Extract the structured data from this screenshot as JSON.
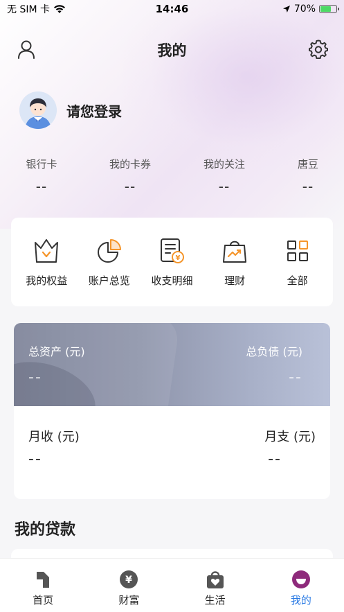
{
  "status_bar": {
    "carrier": "无 SIM 卡",
    "time": "14:46",
    "battery": "70%"
  },
  "header": {
    "title": "我的"
  },
  "profile": {
    "login_prompt": "请您登录"
  },
  "stats": [
    {
      "label": "银行卡",
      "value": "--"
    },
    {
      "label": "我的卡券",
      "value": "--"
    },
    {
      "label": "我的关注",
      "value": "--"
    },
    {
      "label": "唐豆",
      "value": "--"
    }
  ],
  "quick_actions": [
    {
      "label": "我的权益",
      "icon": "crown-icon"
    },
    {
      "label": "账户总览",
      "icon": "pie-chart-icon"
    },
    {
      "label": "收支明细",
      "icon": "bill-icon"
    },
    {
      "label": "理财",
      "icon": "shopping-bag-icon"
    },
    {
      "label": "全部",
      "icon": "grid-icon"
    }
  ],
  "assets": {
    "total_assets_label": "总资产 (元)",
    "total_assets_value": "--",
    "total_liabilities_label": "总负债 (元)",
    "total_liabilities_value": "--",
    "monthly_income_label": "月收 (元)",
    "monthly_income_value": "--",
    "monthly_expense_label": "月支 (元)",
    "monthly_expense_value": "--"
  },
  "loans": {
    "title": "我的贷款"
  },
  "tabs": [
    {
      "label": "首页",
      "icon": "home-icon"
    },
    {
      "label": "财富",
      "icon": "wealth-icon"
    },
    {
      "label": "生活",
      "icon": "life-icon"
    },
    {
      "label": "我的",
      "icon": "me-icon",
      "active": true
    }
  ],
  "colors": {
    "accent": "#f5952a",
    "tab_active": "#2b7be4",
    "me_icon": "#8e2a7b"
  }
}
